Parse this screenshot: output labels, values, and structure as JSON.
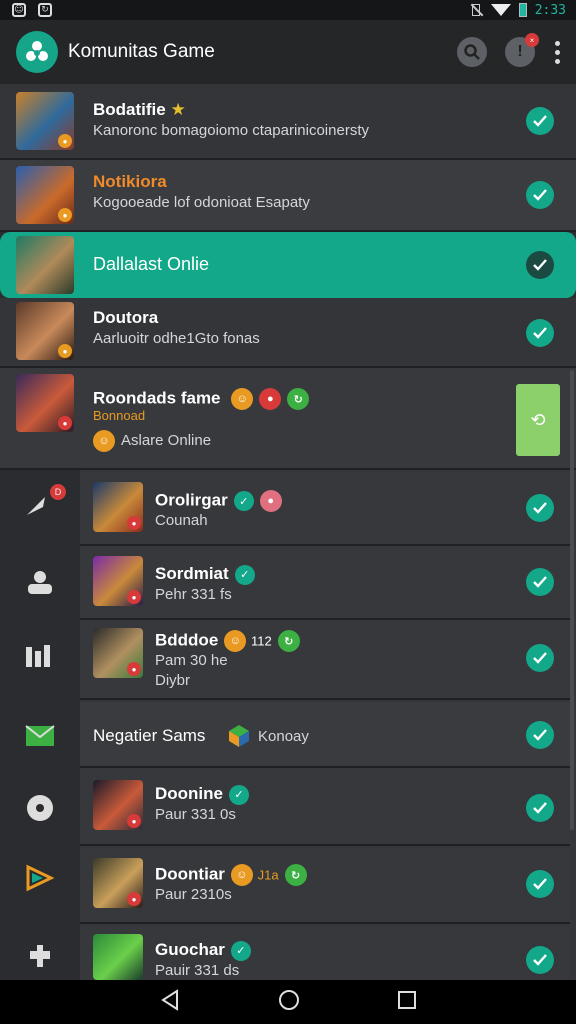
{
  "app": {
    "title": "Komunitas Game"
  },
  "status": {
    "time": "2:33"
  },
  "rows": [
    {
      "title": "Bodatifie",
      "subtitle": "Kanoronc bomagoiomo ctaparinicoinersty"
    },
    {
      "title": "Notikiora",
      "subtitle": "Kogooeade lof odonioat Esapaty"
    },
    {
      "title": "Dallalast Onlie",
      "subtitle": ""
    },
    {
      "title": "Doutora",
      "subtitle": "Aarluoitr odhe1Gto fonas"
    },
    {
      "title": "Roondads fame",
      "tag": "Bonnoad",
      "status": "Aslare Online"
    },
    {
      "title": "Orolirgar",
      "subtitle": "Counah"
    },
    {
      "title": "Sordmiat",
      "subtitle": "Pehr 331 fs"
    },
    {
      "title": "Bdddoe",
      "subtitle": "Pam 30 he",
      "extra": "Diybr",
      "count": "112"
    },
    {
      "title": "Negatier Sams",
      "label2": "Konoay"
    },
    {
      "title": "Doonine",
      "subtitle": "Paur 331 0s"
    },
    {
      "title": "Doontiar",
      "subtitle": "Paur 2310s",
      "count": "J1a"
    },
    {
      "title": "Guochar",
      "subtitle": "Pauir 331 ds"
    }
  ],
  "colors": {
    "accent": "#13a889",
    "alert": "#d83a3a",
    "warn": "#e89a22",
    "online": "#3cb043"
  }
}
